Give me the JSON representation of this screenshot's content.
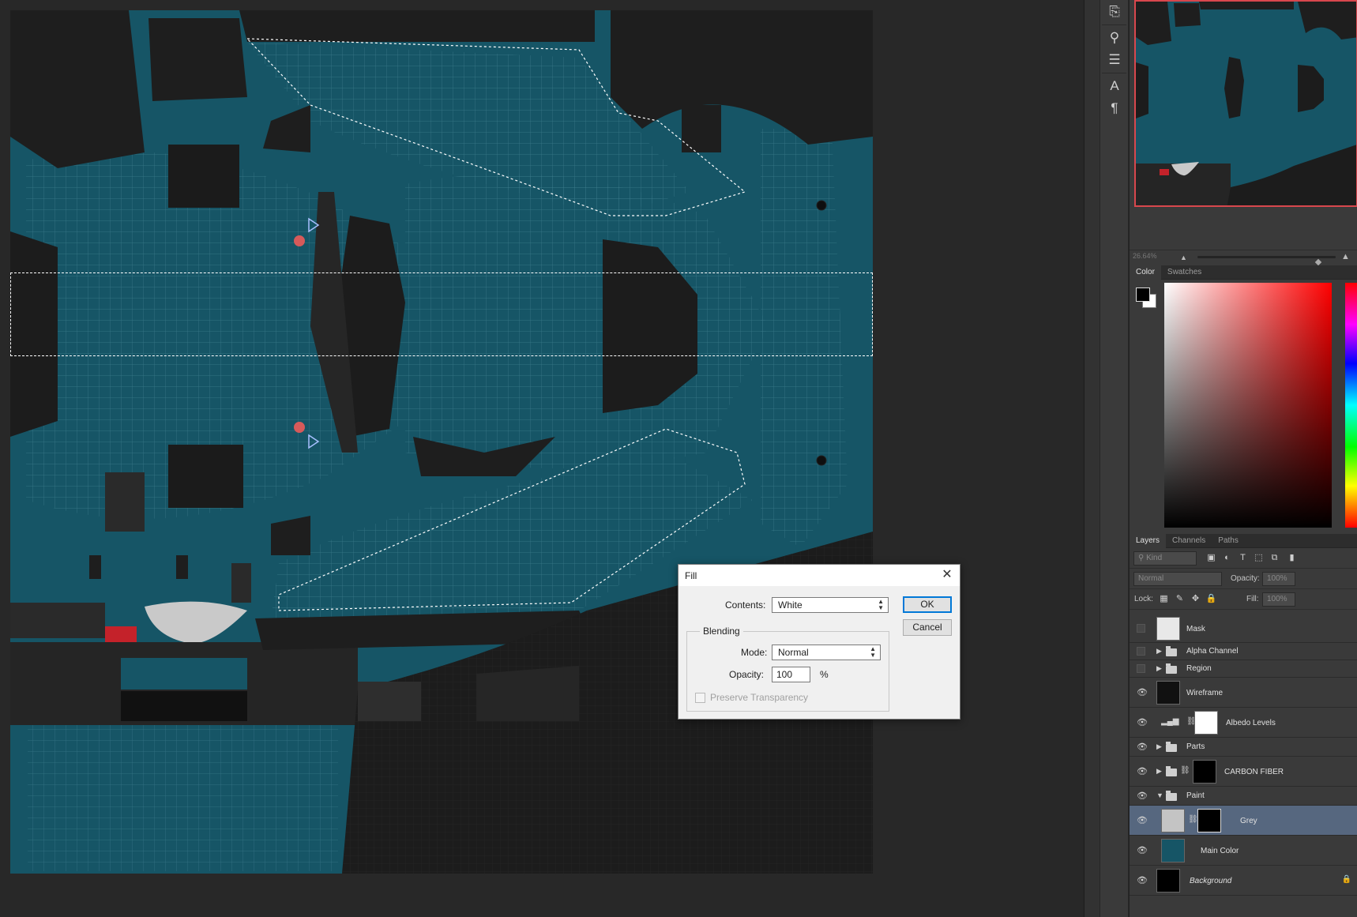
{
  "navigator": {
    "zoom": "26.64%"
  },
  "color_panel": {
    "tabs": [
      "Color",
      "Swatches"
    ],
    "foreground": "#000000",
    "background": "#ffffff"
  },
  "layers_panel": {
    "tabs": [
      "Layers",
      "Channels",
      "Paths"
    ],
    "filter_kind": "Kind",
    "blend_mode": "Normal",
    "opacity_label": "Opacity:",
    "opacity_value": "100%",
    "lock_label": "Lock:",
    "fill_label": "Fill:",
    "fill_value": "100%",
    "layers": [
      {
        "name": "Mask",
        "visible": false,
        "type": "layer"
      },
      {
        "name": "Alpha Channel",
        "visible": false,
        "type": "group"
      },
      {
        "name": "Region",
        "visible": false,
        "type": "group"
      },
      {
        "name": "Wireframe",
        "visible": true,
        "type": "layer"
      },
      {
        "name": "Albedo Levels",
        "visible": true,
        "type": "adjustment"
      },
      {
        "name": "Parts",
        "visible": true,
        "type": "group"
      },
      {
        "name": "CARBON FIBER",
        "visible": true,
        "type": "group"
      },
      {
        "name": "Paint",
        "visible": true,
        "type": "group-open"
      },
      {
        "name": "Grey",
        "visible": true,
        "type": "layer",
        "selected": true
      },
      {
        "name": "Main Color",
        "visible": true,
        "type": "layer"
      },
      {
        "name": "Background",
        "visible": true,
        "type": "background"
      }
    ]
  },
  "fill_dialog": {
    "title": "Fill",
    "contents_label": "Contents:",
    "contents_value": "White",
    "blending_label": "Blending",
    "mode_label": "Mode:",
    "mode_value": "Normal",
    "opacity_label": "Opacity:",
    "opacity_value": "100",
    "opacity_unit": "%",
    "preserve_label": "Preserve Transparency",
    "ok_label": "OK",
    "cancel_label": "Cancel"
  },
  "icons": {
    "eye": "eye-icon",
    "folder": "folder-icon",
    "chain": "link-icon",
    "lock": "lock-icon"
  },
  "colors": {
    "canvas_teal": "#165566",
    "selection_row": "#56677f",
    "navigator_frame": "#d8474d"
  }
}
